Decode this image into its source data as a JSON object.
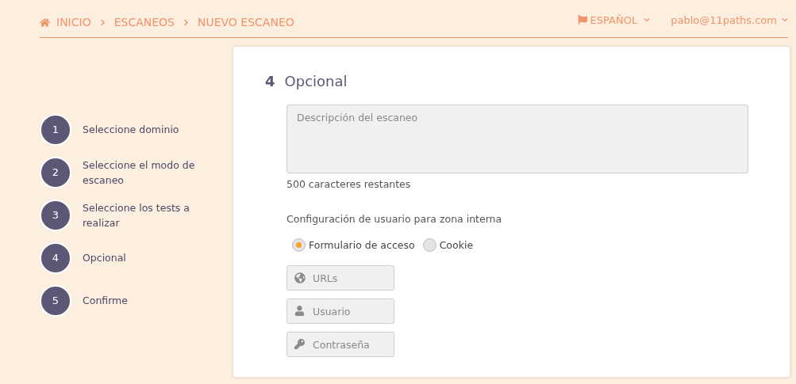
{
  "breadcrumb": [
    {
      "label": "INICIO",
      "kind": "home"
    },
    {
      "label": "ESCANEOS",
      "kind": "plain"
    },
    {
      "label": "NUEVO ESCANEO",
      "kind": "plain"
    }
  ],
  "language": {
    "label": "ESPAÑOL"
  },
  "user": {
    "label": "pablo@11paths.com"
  },
  "steps": [
    {
      "number": "1",
      "label": "Seleccione dominio"
    },
    {
      "number": "2",
      "label": "Seleccione el modo de escaneo"
    },
    {
      "number": "3",
      "label": "Seleccione los tests a realizar"
    },
    {
      "number": "4",
      "label": "Opcional"
    },
    {
      "number": "5",
      "label": "Confirme"
    }
  ],
  "section": {
    "number": "4",
    "title": "Opcional"
  },
  "description": {
    "placeholder": "Descripción del escaneo"
  },
  "char_count": "500 caracteres restantes",
  "config_label": "Configuración de usuario para zona interna",
  "radios": [
    {
      "label": "Formulario de acceso",
      "selected": true
    },
    {
      "label": "Cookie",
      "selected": false
    }
  ],
  "fields": [
    {
      "placeholder": "URLs",
      "kind": "globe"
    },
    {
      "placeholder": "Usuario",
      "kind": "user"
    },
    {
      "placeholder": "Contraseña",
      "kind": "key"
    }
  ]
}
